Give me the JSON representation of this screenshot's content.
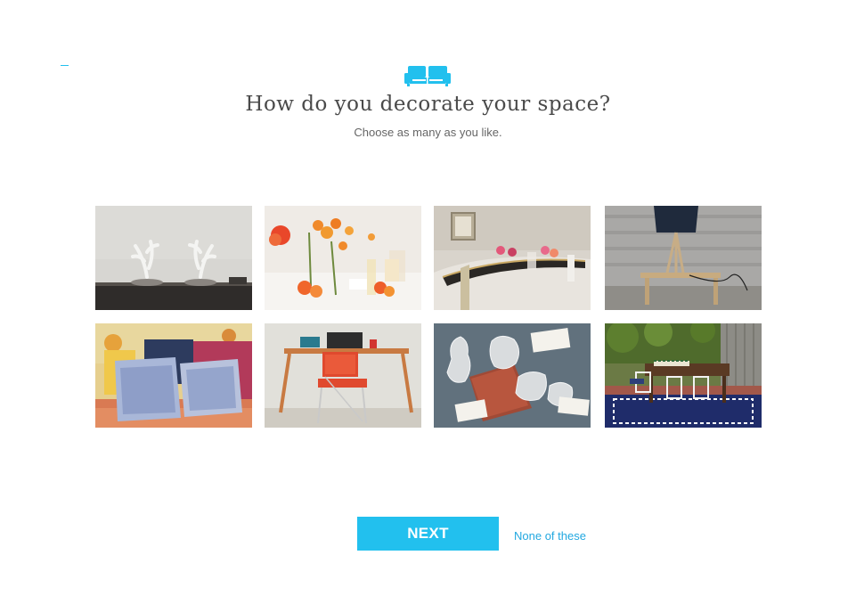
{
  "header": {
    "icon": "sofa-icon",
    "title": "How do you decorate your space?",
    "subtitle": "Choose as many as you like."
  },
  "options": [
    {
      "icon": "antlers-decor-photo"
    },
    {
      "icon": "orange-flowers-table-photo"
    },
    {
      "icon": "mirrored-dining-table-photo"
    },
    {
      "icon": "wooden-lamp-photo"
    },
    {
      "icon": "blue-pillows-photo"
    },
    {
      "icon": "orange-chair-desk-photo"
    },
    {
      "icon": "silver-hands-photo"
    },
    {
      "icon": "outdoor-dining-photo"
    }
  ],
  "actions": {
    "next_label": "NEXT",
    "none_label": "None of these"
  },
  "colors": {
    "accent": "#22c0ee",
    "link": "#22a8e0",
    "title": "#4a4a4a",
    "subtitle": "#666666"
  }
}
